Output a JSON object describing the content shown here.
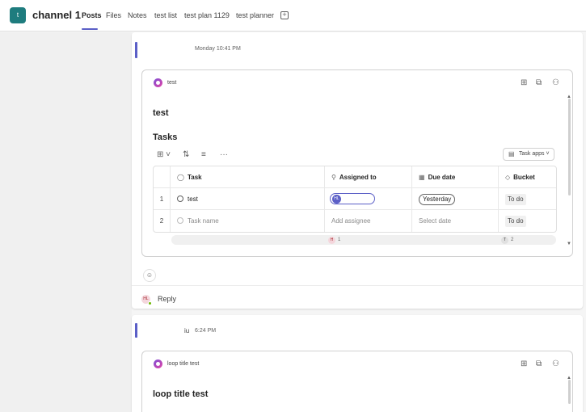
{
  "header": {
    "channel_initial": "t",
    "channel_name": "channel 1",
    "tabs": [
      "Posts",
      "Files",
      "Notes",
      "test list",
      "test plan 1129",
      "test planner"
    ],
    "active_tab": "Posts",
    "add_tab_icon": "plus-square-icon"
  },
  "messages": [
    {
      "author": "",
      "time": "Monday 10:41 PM",
      "loop": {
        "name": "test",
        "title": "test",
        "section": "Tasks",
        "task_apps_label": "Task apps",
        "columns": [
          "Task",
          "Assigned to",
          "Due date",
          "Bucket"
        ],
        "rows": [
          {
            "num": "1",
            "task": "test",
            "assignee_initials": "HL",
            "due": "Yesterday",
            "bucket": "To do"
          },
          {
            "num": "2",
            "task": "Task name",
            "assignee": "Add assignee",
            "due": "Select date",
            "bucket": "To do"
          }
        ],
        "presence": [
          {
            "initial": "H",
            "count": "1"
          },
          {
            "initial": "T",
            "count": "2"
          }
        ]
      },
      "reply_avatar": "HL",
      "reply_label": "Reply"
    },
    {
      "author": "iu",
      "time": "6:24 PM",
      "loop": {
        "name": "loop title test",
        "title": "loop title test"
      }
    }
  ],
  "colors": {
    "accent": "#5b5fc7",
    "channel_avatar": "#1e7c7e"
  }
}
